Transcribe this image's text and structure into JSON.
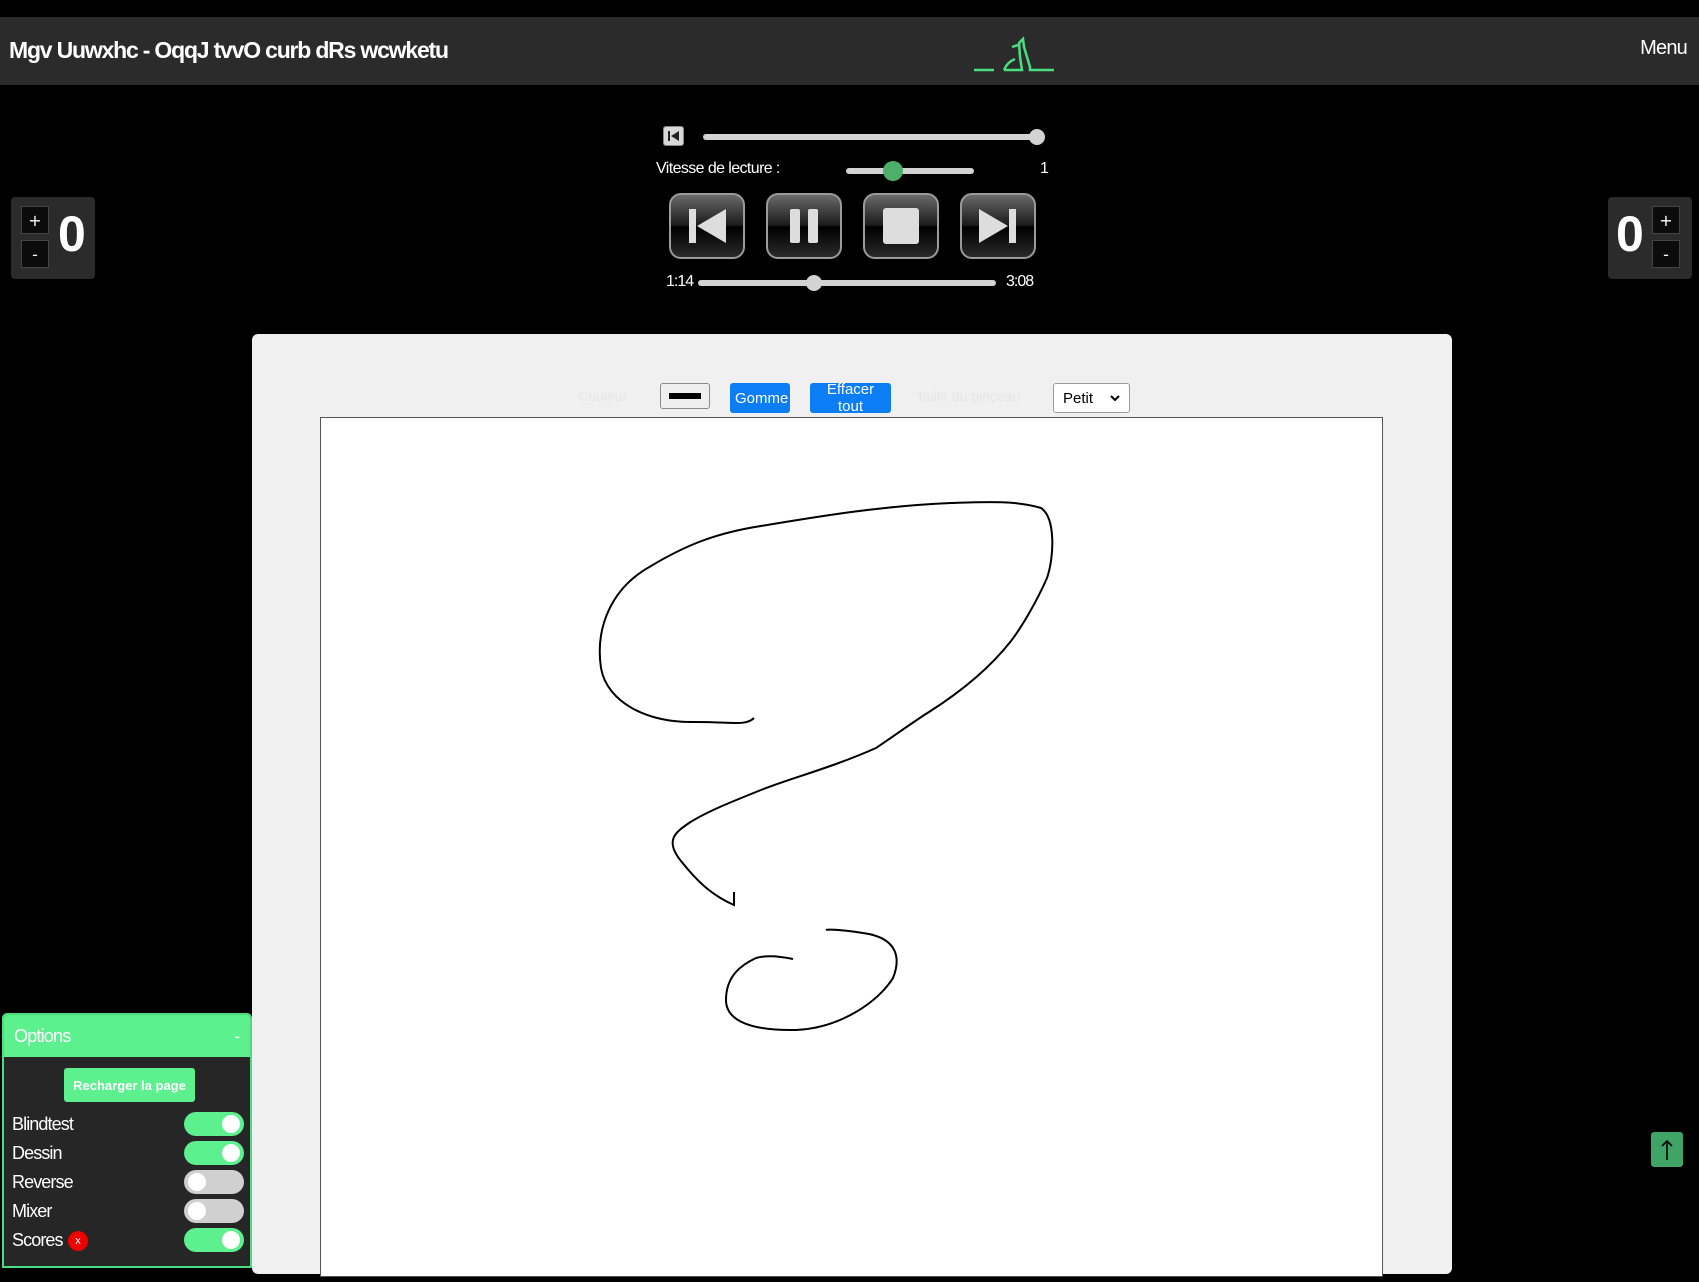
{
  "header": {
    "title": "Mgv Uuwxhc - OqqJ tvvO curb dRs wcwketu",
    "menu_label": "Menu"
  },
  "player": {
    "speed_label": "Vitesse de lecture :",
    "speed_value": "1",
    "current_time": "1:14",
    "total_time": "3:08",
    "progress_fraction": 0.39,
    "volume_fraction": 1.0,
    "speed_fraction": 0.36
  },
  "scores": {
    "left_value": "0",
    "right_value": "0",
    "plus": "+",
    "minus": "-"
  },
  "drawing_tools": {
    "color_label": "Couleur",
    "eraser_label": "Gomme",
    "clear_label": "Effacer tout",
    "brush_size_label": "Taille du pinceau",
    "brush_size_value": "Petit"
  },
  "options": {
    "title": "Options",
    "collapse": "-",
    "reload_label": "Recharger la page",
    "items": [
      {
        "label": "Blindtest",
        "on": true
      },
      {
        "label": "Dessin",
        "on": true
      },
      {
        "label": "Reverse",
        "on": false
      },
      {
        "label": "Mixer",
        "on": false
      },
      {
        "label": "Scores",
        "on": true
      }
    ],
    "scores_reset": "x"
  },
  "colors": {
    "accent_green": "#5cf08f",
    "button_blue": "#0b7df5",
    "topbar": "#2b2b2b"
  },
  "icons": {
    "logo": "wine-glass-logo",
    "scroll_top": "arrow-up-icon"
  }
}
